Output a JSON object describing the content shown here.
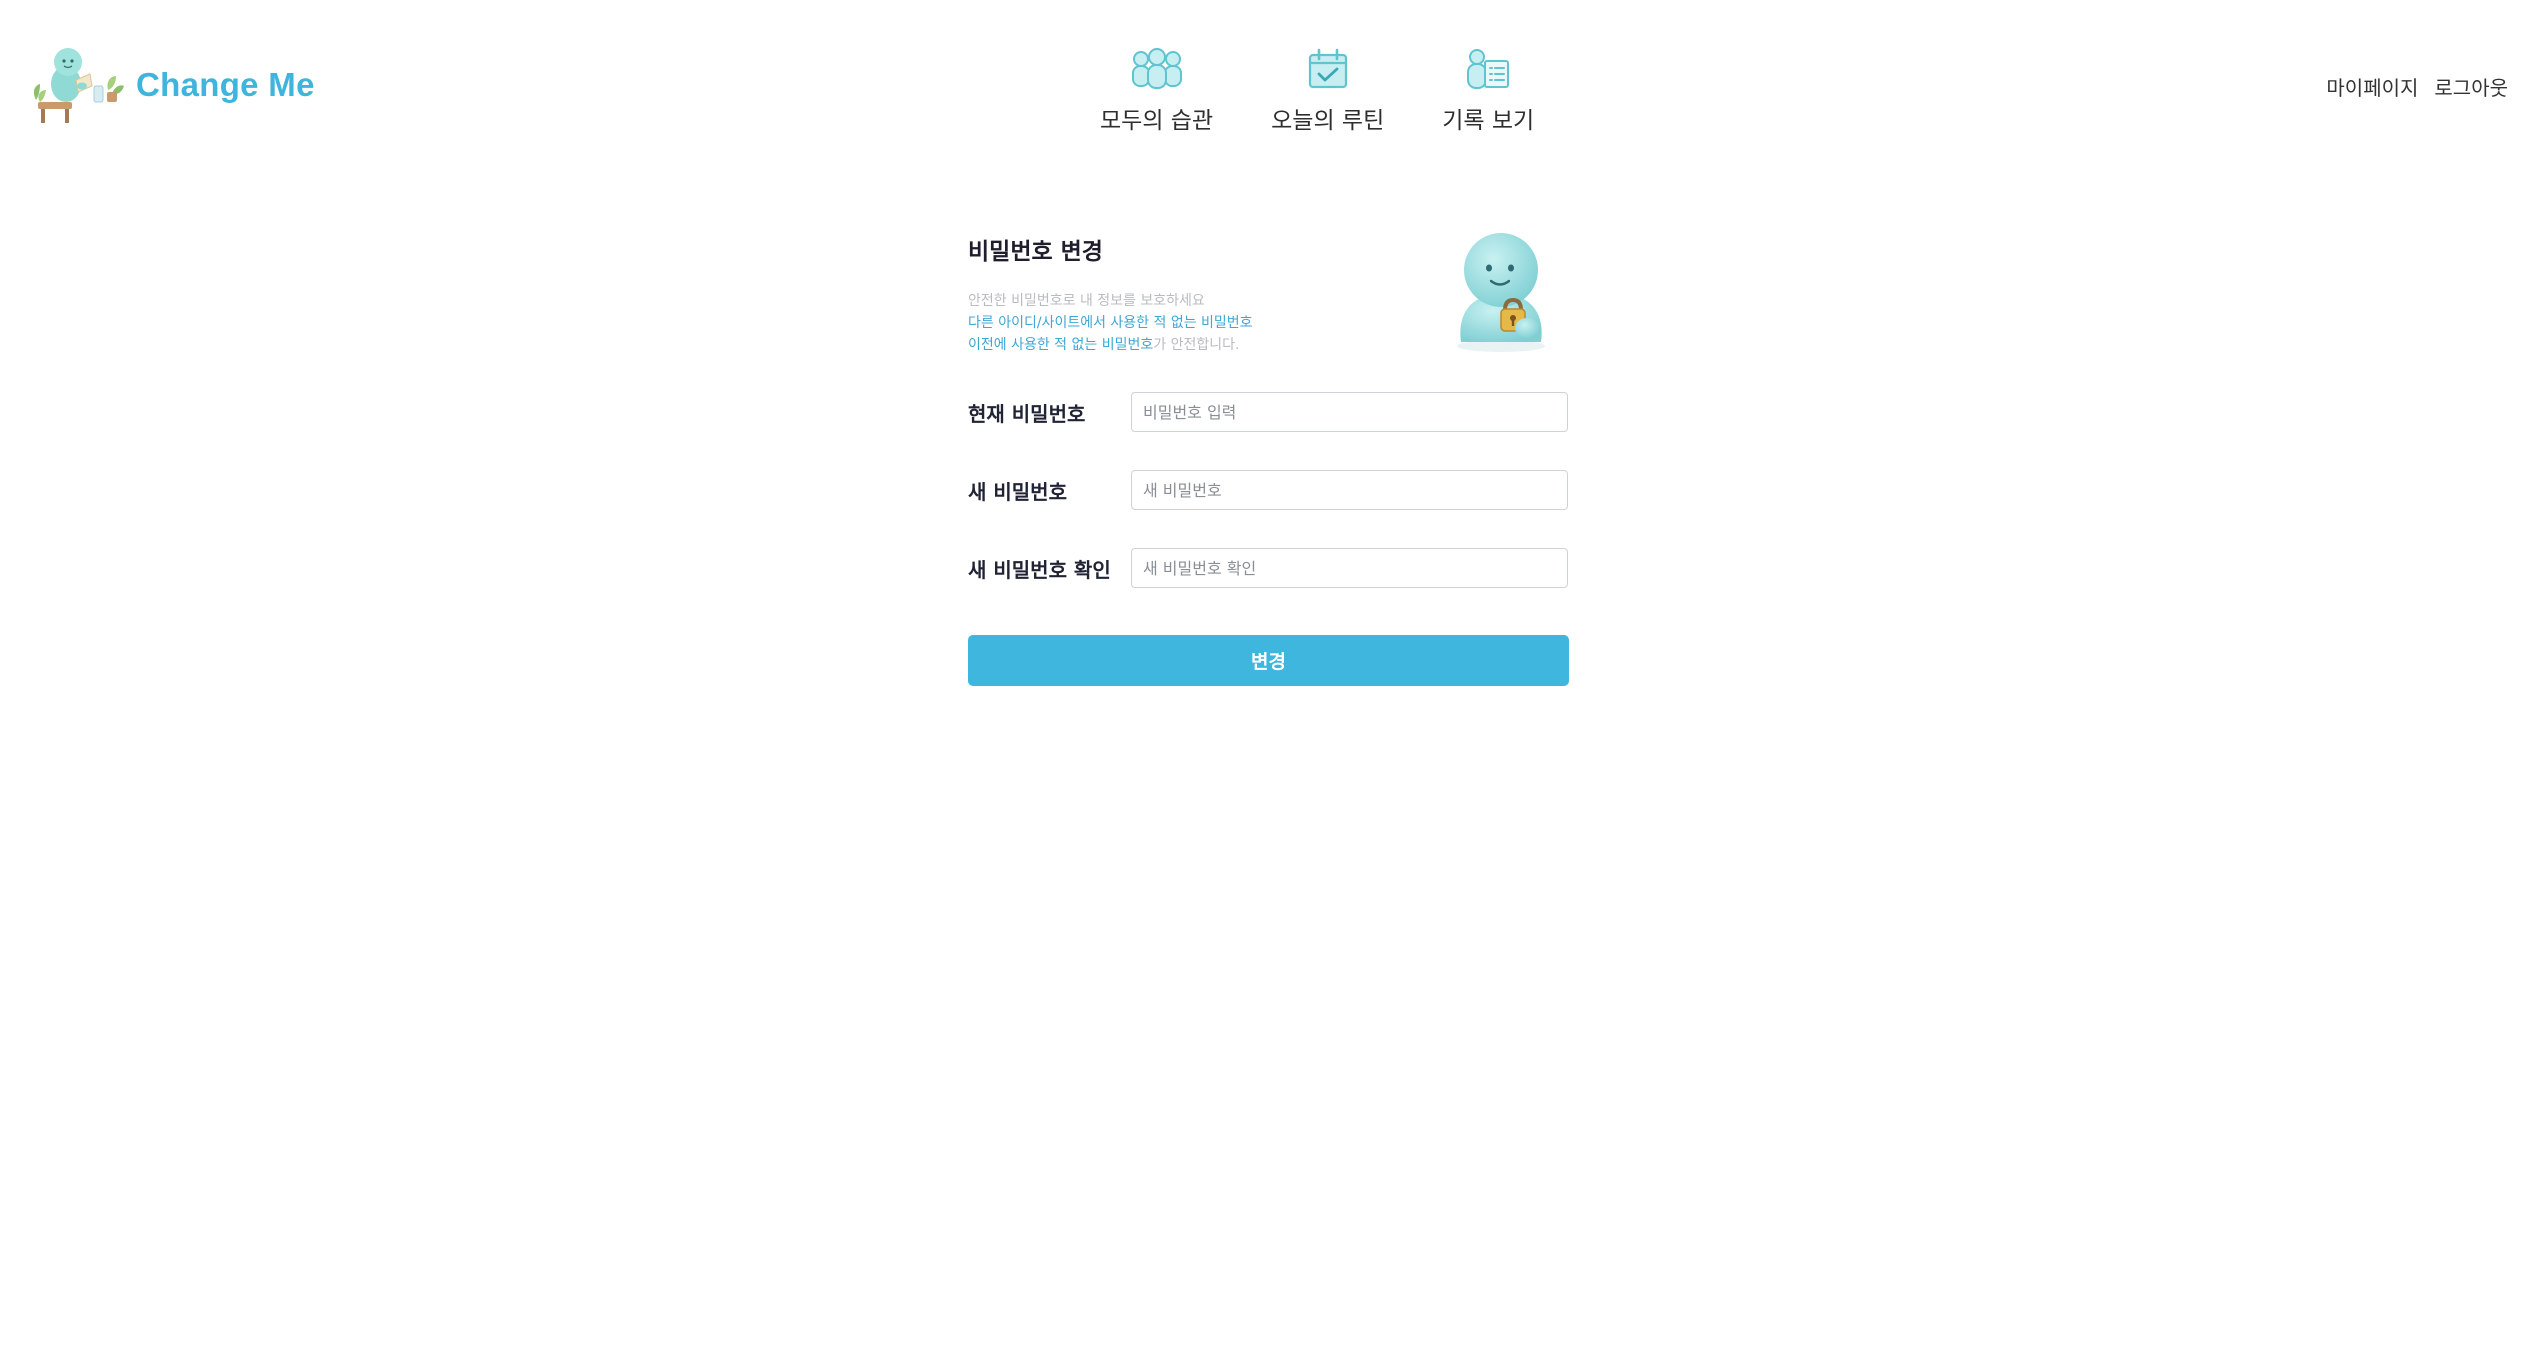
{
  "brand": {
    "name": "Change Me",
    "logo_icon": "mascot-reading-logo-icon",
    "color": "#3fb5dd"
  },
  "nav": {
    "items": [
      {
        "label": "모두의 습관",
        "icon": "people-group-icon"
      },
      {
        "label": "오늘의 루틴",
        "icon": "calendar-check-icon"
      },
      {
        "label": "기록 보기",
        "icon": "person-list-icon"
      }
    ]
  },
  "user_menu": {
    "mypage": "마이페이지",
    "logout": "로그아웃"
  },
  "form": {
    "title": "비밀번호 변경",
    "desc_line1": "안전한 비밀번호로 내 정보를 보호하세요",
    "desc_line2": "다른 아이디/사이트에서 사용한 적 없는 비밀번호",
    "desc_line3_hl": "이전에 사용한 적 없는 비밀번호",
    "desc_line3_tail": "가 안전합니다.",
    "mascot_icon": "mascot-lock-icon",
    "fields": [
      {
        "label": "현재 비밀번호",
        "placeholder": "비밀번호 입력",
        "value": ""
      },
      {
        "label": "새 비밀번호",
        "placeholder": "새 비밀번호",
        "value": ""
      },
      {
        "label": "새 비밀번호 확인",
        "placeholder": "새 비밀번호 확인",
        "value": ""
      }
    ],
    "submit_label": "변경",
    "accent_color": "#3fb6de"
  }
}
